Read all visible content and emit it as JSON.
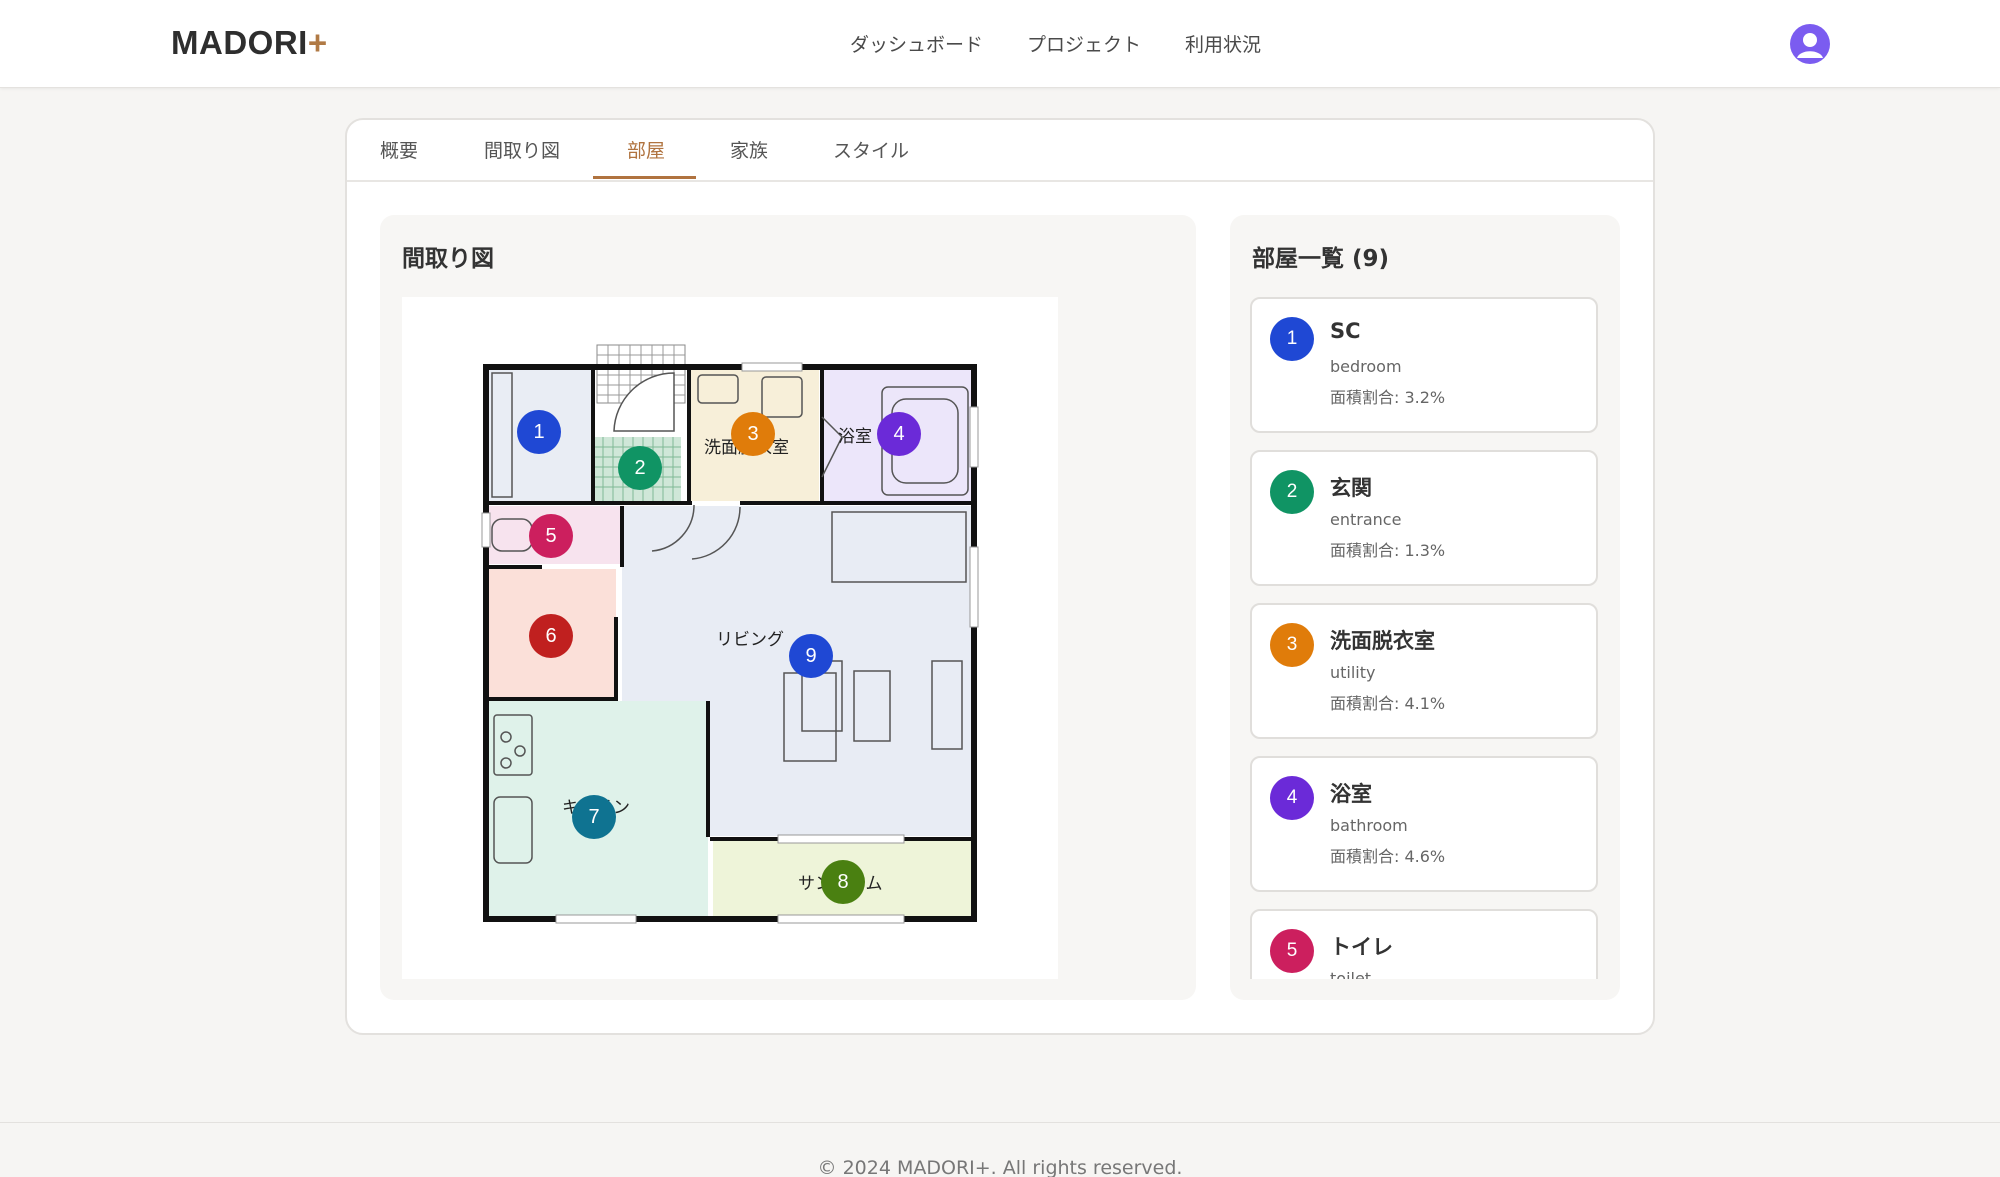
{
  "app": {
    "logo_text": "MADORI",
    "logo_plus": "+",
    "nav": [
      "ダッシュボード",
      "プロジェクト",
      "利用状況"
    ],
    "accent": "#b0733f",
    "avatar_color": "#7b5cf0"
  },
  "tabs": [
    {
      "label": "概要",
      "active": false
    },
    {
      "label": "間取り図",
      "active": false
    },
    {
      "label": "部屋",
      "active": true
    },
    {
      "label": "家族",
      "active": false
    },
    {
      "label": "スタイル",
      "active": false
    }
  ],
  "plan": {
    "title": "間取り図",
    "labels": {
      "washroom": "洗面脱衣室",
      "bath": "浴室",
      "living": "リビング",
      "kitchen": "キッチン",
      "sunroom": "サンルーム"
    },
    "markers": [
      {
        "num": "1",
        "color": "#1f48d4"
      },
      {
        "num": "2",
        "color": "#109464"
      },
      {
        "num": "3",
        "color": "#e07c0a"
      },
      {
        "num": "4",
        "color": "#6b2ad8"
      },
      {
        "num": "5",
        "color": "#cc1f5e"
      },
      {
        "num": "6",
        "color": "#c0201f"
      },
      {
        "num": "7",
        "color": "#0f7391"
      },
      {
        "num": "8",
        "color": "#4a8011"
      },
      {
        "num": "9",
        "color": "#1f48d4"
      }
    ]
  },
  "rooms_panel": {
    "title": "部屋一覧 (9)",
    "items": [
      {
        "num": "1",
        "name": "SC",
        "type": "bedroom",
        "ratio": "面積割合: 3.2%",
        "color": "#1f48d4"
      },
      {
        "num": "2",
        "name": "玄関",
        "type": "entrance",
        "ratio": "面積割合: 1.3%",
        "color": "#109464"
      },
      {
        "num": "3",
        "name": "洗面脱衣室",
        "type": "utility",
        "ratio": "面積割合: 4.1%",
        "color": "#e07c0a"
      },
      {
        "num": "4",
        "name": "浴室",
        "type": "bathroom",
        "ratio": "面積割合: 4.6%",
        "color": "#6b2ad8"
      },
      {
        "num": "5",
        "name": "トイレ",
        "type": "toilet",
        "ratio": "",
        "color": "#cc1f5e"
      }
    ]
  },
  "footer": {
    "text": "© 2024 MADORI+. All rights reserved."
  }
}
